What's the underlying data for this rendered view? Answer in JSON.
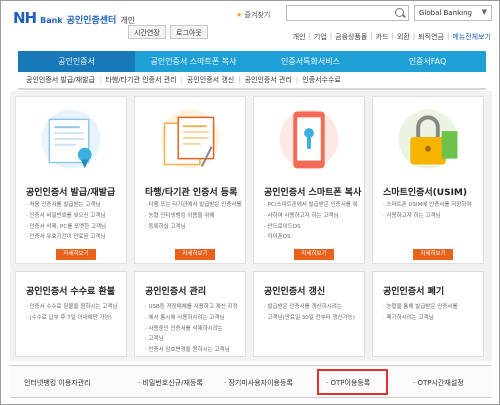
{
  "header": {
    "logo": "NH",
    "bank": "Bank",
    "service": "공인인증센터",
    "sub": "개인",
    "favorite": "즐겨찾기",
    "search_placeholder": "",
    "global": "Global Banking",
    "util_buttons": [
      "시간연장",
      "로그아웃"
    ],
    "topnav": [
      "개인",
      "기업",
      "금융상품몰",
      "카드",
      "외환",
      "퇴직연금"
    ],
    "menu_all": "메뉴전체보기"
  },
  "gnb": {
    "items": [
      "공인인증서",
      "공인인증서 스마트폰 복사",
      "인증서특화서비스",
      "인증서FAQ"
    ]
  },
  "subnav": {
    "items": [
      "공인인증서 발급/재발급",
      "타행/타기관 인증서 관리",
      "공인인증서 갱신",
      "공인인증서 관리",
      "인증서수수료"
    ]
  },
  "cards_top": [
    {
      "title": "공인인증서 발급/재발급",
      "lines": [
        "처음 인증서를 발급받는 고객님",
        "인증서 비밀번호를 잊으신 고객님",
        "인증서 삭제, PC를 포맷한 고객님",
        "인증서 유효기간이 만료된 고객님"
      ],
      "button": "자세히보기"
    },
    {
      "title": "타행/타기관 인증서 등록",
      "lines": [
        "타행 또는 타기관에서 발급받은 인증서를",
        "농협 인터넷뱅킹 이용을 위해",
        "등록하실 고객님"
      ],
      "button": "자세히보기"
    },
    {
      "title": "공인인증서 스마트폰 복사",
      "lines": [
        "PC/스마트폰에서 발급받은 인증서를 복",
        "사하여 사용하고자 하는 고객님",
        "안드로이드OS",
        "아이폰OS"
      ],
      "button": "자세히보기"
    },
    {
      "title": "스마트인증서(USIM)",
      "lines": [
        "스마트폰 USIM에 인증서를 저장하여",
        "사용하고자 하는 고객님"
      ],
      "button": "자세히보기"
    }
  ],
  "cards_bottom": [
    {
      "title": "공인인증서 수수료 환불",
      "lines": [
        "인증서 수수료 환불을 원하시는 고객님",
        "(수수료 납부 후 7일 이내에만 가능)"
      ]
    },
    {
      "title": "공인인증서 관리",
      "lines": [
        "USB등 저장매체를 사용하고 계신 지정",
        "에서 통시에 사용하시려는 고객님",
        "사용중인 인증서를 삭제하시려는",
        "고객님",
        "인증서 암호변경을 원하시는 고객님"
      ]
    },
    {
      "title": "공인인증서 갱신",
      "lines": [
        "발급받은 인증서를 갱신하시려는",
        "고객님(만료일 30일 전부터 갱신가능)"
      ]
    },
    {
      "title": "공인인증서 폐기",
      "lines": [
        "농협을 통해 발급받은 인증서를",
        "폐기하시려는 고객님"
      ]
    }
  ],
  "bottom_bar": {
    "label": "인터넷뱅킹 이용자관리",
    "items": [
      "비밀번호신규/재등록",
      "장기미사용자이용등록",
      "OTP이용등록",
      "OTP시간재설정"
    ]
  },
  "colors": {
    "brand": "#1e63b7",
    "gnb": "#1e9fd6",
    "gnb_active": "#1779b8",
    "button": "#e8621c",
    "highlight": "#e03030"
  }
}
